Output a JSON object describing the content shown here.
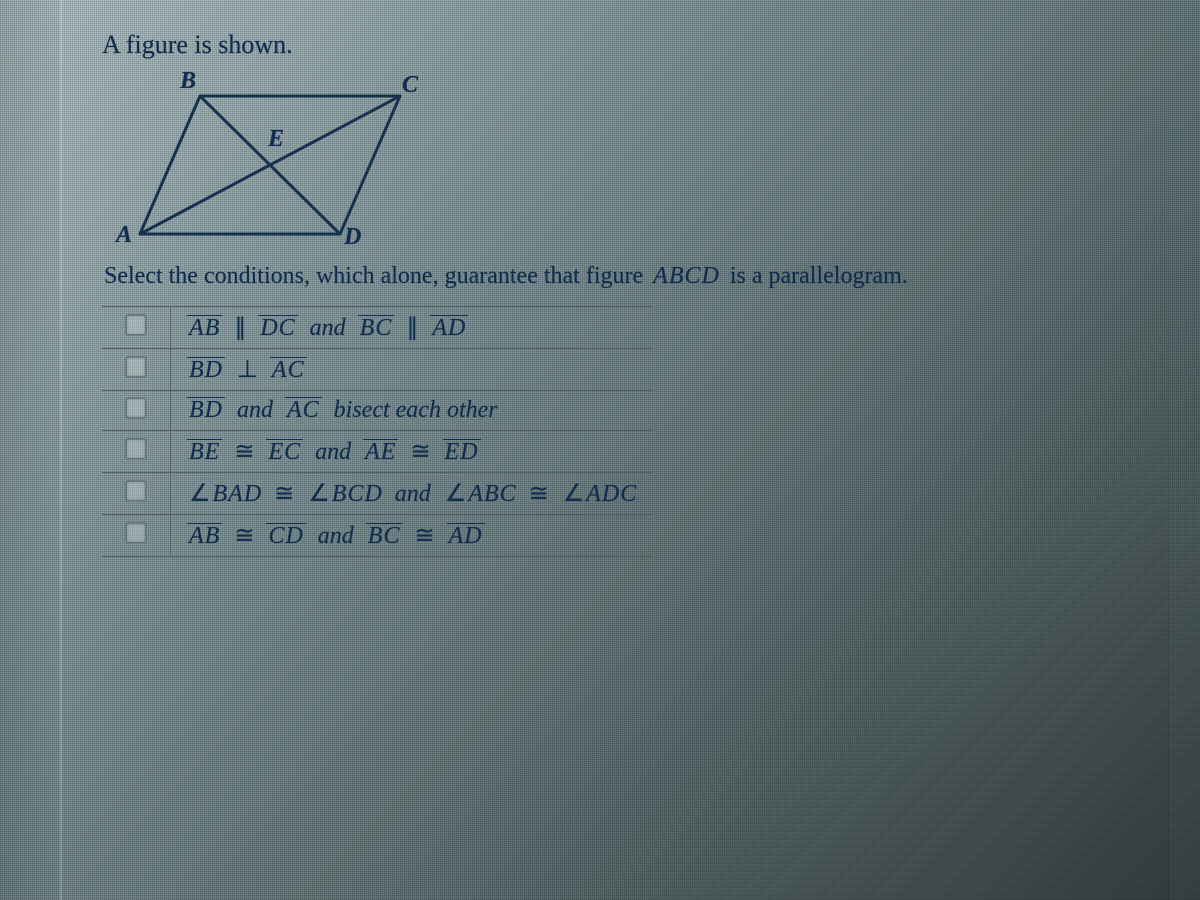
{
  "prompt": "A figure is shown.",
  "figure": {
    "labels": {
      "A": "A",
      "B": "B",
      "C": "C",
      "D": "D",
      "E": "E"
    }
  },
  "instruction": {
    "pre": "Select the conditions, which alone, guarantee that figure ",
    "figname": "ABCD",
    "post": " is a parallelogram."
  },
  "symbols": {
    "parallel": "∥",
    "perp": "⊥",
    "cong": "≅",
    "and": "and"
  },
  "options": [
    {
      "segA1": "AB",
      "rel1": "parallel",
      "segA2": "DC",
      "join": "and",
      "segB1": "BC",
      "rel2": "parallel",
      "segB2": "AD"
    },
    {
      "segA1": "BD",
      "rel1": "perp",
      "segA2": "AC"
    },
    {
      "type": "bisect",
      "seg1": "BD",
      "mid": "and",
      "seg2": "AC",
      "tail": "bisect each other"
    },
    {
      "segA1": "BE",
      "rel1": "cong",
      "segA2": "EC",
      "join": "and",
      "segB1": "AE",
      "rel2": "cong",
      "segB2": "ED"
    },
    {
      "type": "angles",
      "a1": "BAD",
      "r1": "cong",
      "a2": "BCD",
      "join": "and",
      "a3": "ABC",
      "r2": "cong",
      "a4": "ADC"
    },
    {
      "segA1": "AB",
      "rel1": "cong",
      "segA2": "CD",
      "join": "and",
      "segB1": "BC",
      "rel2": "cong",
      "segB2": "AD"
    }
  ]
}
